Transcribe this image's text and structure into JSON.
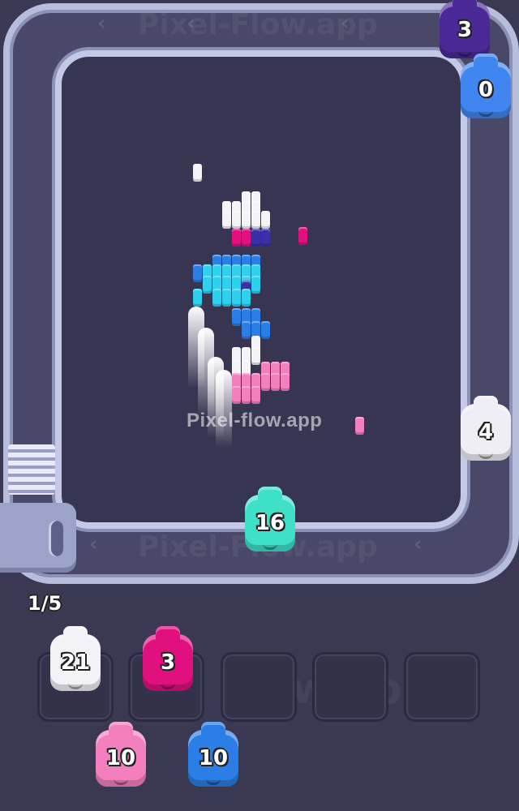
{
  "watermark": "Pixel-flow.app",
  "track_watermark": "Pixel-Flow.app",
  "slots_watermark": "Flow.app",
  "progress": "1/5",
  "track_chevron": "‹",
  "colors": {
    "white": "#f4f4f8",
    "magenta": "#e0117f",
    "cyan": "#2fd0ee",
    "blue": "#2b7ee6",
    "navy": "#3b2fa8",
    "pink": "#f47fbf",
    "mint": "#3fe0c8",
    "violet": "#4b2a98"
  },
  "track_shooters": [
    {
      "id": "violet",
      "count": "3",
      "color": "#4b2a98"
    },
    {
      "id": "blue",
      "count": "0",
      "color": "#3f86f0"
    },
    {
      "id": "white",
      "count": "4",
      "color": "#eeeef4"
    },
    {
      "id": "mint",
      "count": "16",
      "color": "#3fe0c8"
    }
  ],
  "slots": [
    {
      "count": "21",
      "color": "#f2f2f7"
    },
    {
      "count": "3",
      "color": "#e0117f"
    },
    {
      "count": ""
    },
    {
      "count": ""
    },
    {
      "count": ""
    }
  ],
  "queue": [
    {
      "count": "10",
      "color": "#f47fbf"
    },
    {
      "count": "10",
      "color": "#2b7ee6"
    }
  ]
}
